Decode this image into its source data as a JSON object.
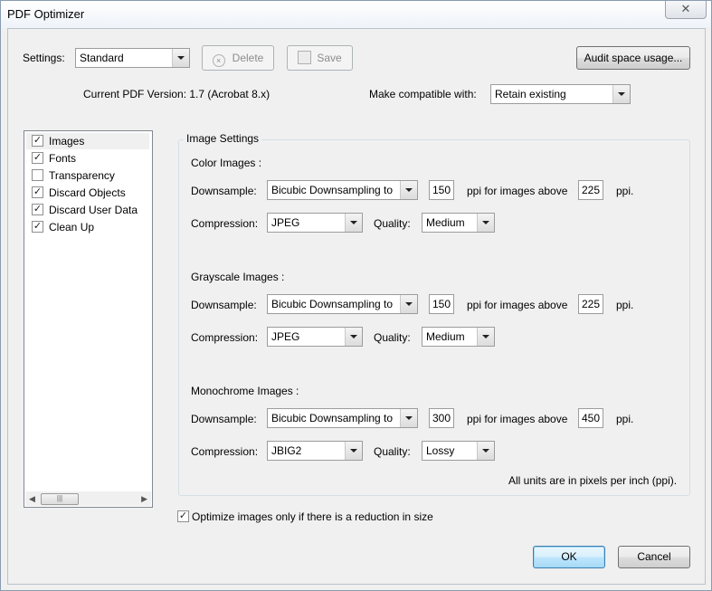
{
  "window": {
    "title": "PDF Optimizer",
    "close_glyph": "✕"
  },
  "settings": {
    "label": "Settings:",
    "value": "Standard",
    "delete_label": "Delete",
    "save_label": "Save",
    "audit_label": "Audit space usage..."
  },
  "version": {
    "current_text": "Current PDF Version: 1.7 (Acrobat 8.x)",
    "compat_label": "Make compatible with:",
    "compat_value": "Retain existing"
  },
  "panels": [
    {
      "label": "Images",
      "checked": true,
      "selected": true
    },
    {
      "label": "Fonts",
      "checked": true
    },
    {
      "label": "Transparency",
      "checked": false
    },
    {
      "label": "Discard Objects",
      "checked": true
    },
    {
      "label": "Discard User Data",
      "checked": true
    },
    {
      "label": "Clean Up",
      "checked": true
    }
  ],
  "image_settings": {
    "title": "Image Settings",
    "labels": {
      "downsample": "Downsample:",
      "ppi_above": "ppi for images above",
      "ppi": "ppi.",
      "compression": "Compression:",
      "quality": "Quality:"
    },
    "color": {
      "heading": "Color Images :",
      "method": "Bicubic Downsampling to",
      "ppi": "150",
      "above": "225",
      "compression": "JPEG",
      "quality": "Medium"
    },
    "grayscale": {
      "heading": "Grayscale Images :",
      "method": "Bicubic Downsampling to",
      "ppi": "150",
      "above": "225",
      "compression": "JPEG",
      "quality": "Medium"
    },
    "monochrome": {
      "heading": "Monochrome Images :",
      "method": "Bicubic Downsampling to",
      "ppi": "300",
      "above": "450",
      "compression": "JBIG2",
      "quality": "Lossy"
    },
    "units_note": "All units are in pixels per inch (ppi)."
  },
  "optimize_only_reduction": {
    "label": "Optimize images only if there is a reduction in size",
    "checked": true
  },
  "footer": {
    "ok_label": "OK",
    "cancel_label": "Cancel"
  }
}
